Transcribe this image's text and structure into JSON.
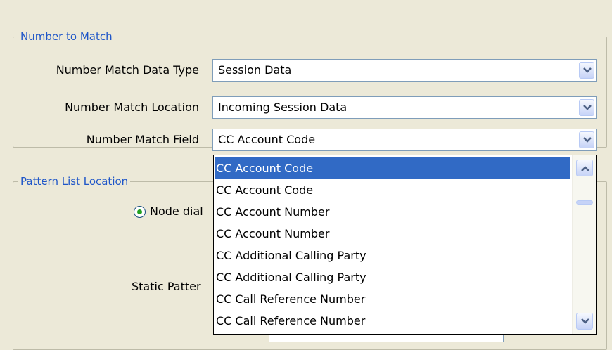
{
  "number_to_match": {
    "legend": "Number to Match",
    "data_type": {
      "label": "Number Match Data Type",
      "value": "Session Data"
    },
    "location": {
      "label": "Number Match Location",
      "value": "Incoming Session Data"
    },
    "field": {
      "label": "Number Match Field",
      "value": "CC Account Code"
    }
  },
  "pattern_list_location": {
    "legend": "Pattern List Location",
    "radio_node_label_partial": "Node dial",
    "static_pattern_label_partial": "Static Patter"
  },
  "dropdown": {
    "items": [
      "CC Account Code",
      "CC Account Code",
      "CC Account Number",
      "CC Account Number",
      "CC Additional Calling Party",
      "CC Additional Calling Party",
      "CC Call Reference Number",
      "CC Call Reference Number"
    ],
    "selected_index": 0
  },
  "colors": {
    "selection": "#316ac5",
    "legend_text": "#1f56c8",
    "radio_dot": "#21a121"
  }
}
